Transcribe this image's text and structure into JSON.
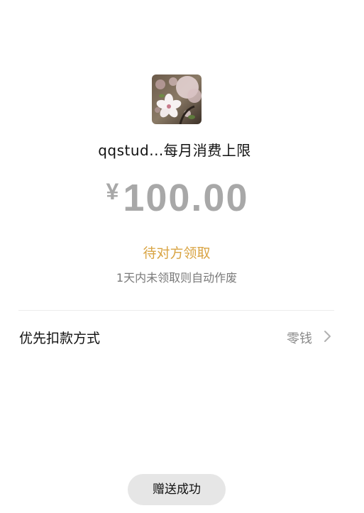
{
  "recipient": {
    "avatar_icon": "cherry-blossom-photo",
    "title": "qqstud...每月消费上限"
  },
  "amount": {
    "currency_symbol": "¥",
    "value": "100.00"
  },
  "status": {
    "text": "待对方领取",
    "color": "#d9a443",
    "note": "1天内未领取则自动作废"
  },
  "payment_method": {
    "label": "优先扣款方式",
    "value": "零钱",
    "chevron_icon": "chevron-right-icon"
  },
  "footer": {
    "done_label": "赠送成功"
  }
}
